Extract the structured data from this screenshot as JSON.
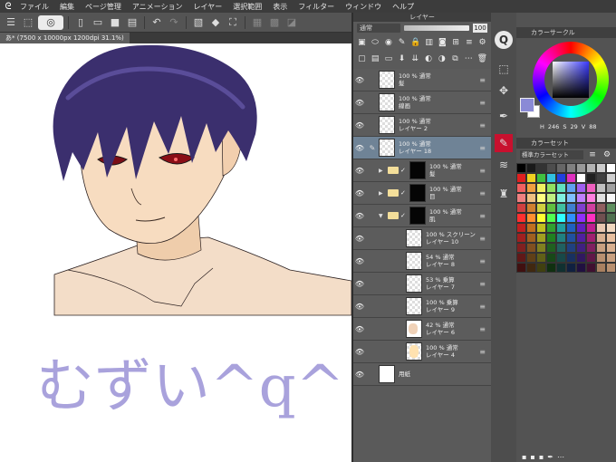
{
  "menubar": {
    "app_icon": "clip-studio-icon",
    "items": [
      "ファイル",
      "編集",
      "ページ管理",
      "アニメーション",
      "レイヤー",
      "選択範囲",
      "表示",
      "フィルター",
      "ウィンドウ",
      "ヘルプ"
    ]
  },
  "canvas_tab": {
    "label": "あ* (7500 x 10000px 1200dpi 31.1%)"
  },
  "canvas": {
    "handwriting": "むずい^q^",
    "handwriting_color": "#a9a2dc"
  },
  "layer_panel": {
    "title": "レイヤー",
    "blend_mode": "通常",
    "opacity": "100",
    "layers": [
      {
        "mode": "100 % 通常",
        "name": "髪"
      },
      {
        "mode": "100 % 通常",
        "name": "線画"
      },
      {
        "mode": "100 % 通常",
        "name": "レイヤー 2"
      },
      {
        "mode": "100 % 通常",
        "name": "レイヤー 18"
      },
      {
        "mode": "100 % 通常",
        "name": "髪"
      },
      {
        "mode": "100 % 通常",
        "name": "目"
      },
      {
        "mode": "100 % 通常",
        "name": "肌"
      },
      {
        "mode": "100 % スクリーン",
        "name": "レイヤー 10"
      },
      {
        "mode": "54 % 通常",
        "name": "レイヤー 8"
      },
      {
        "mode": "53 % 乗算",
        "name": "レイヤー 7"
      },
      {
        "mode": "100 % 乗算",
        "name": "レイヤー 9"
      },
      {
        "mode": "42 % 通常",
        "name": "レイヤー 6"
      },
      {
        "mode": "100 % 通常",
        "name": "レイヤー 4"
      },
      {
        "mode": "",
        "name": "用紙"
      }
    ]
  },
  "color_circle": {
    "title": "カラーサークル",
    "h": "246",
    "s": "29",
    "v": "88",
    "current_color": "#8a8ad6"
  },
  "color_set": {
    "title": "カラーセット",
    "set_name": "標準カラーセット"
  },
  "palette": [
    "#000000",
    "#1a1a1a",
    "#333333",
    "#4d4d4d",
    "#666666",
    "#808080",
    "#999999",
    "#b3b3b3",
    "#cccccc",
    "#ffffff",
    "#e02020",
    "#f0d020",
    "#40c040",
    "#30c0e0",
    "#2040e0",
    "#e030c0",
    "#ffffff",
    "#202020",
    "#404040",
    "#d0d0d0",
    "#f06060",
    "#f0a040",
    "#f0f060",
    "#90e060",
    "#60e0c0",
    "#60a0f0",
    "#a060f0",
    "#f060c0",
    "#c0c0c0",
    "#a0a0a0",
    "#f08080",
    "#f0c080",
    "#ffff80",
    "#c0f080",
    "#80f0e0",
    "#80c0ff",
    "#c080ff",
    "#ff80e0",
    "#e0e0e0",
    "#f8f8f8",
    "#d04040",
    "#d08030",
    "#d0d040",
    "#60c040",
    "#40c0a0",
    "#4080d0",
    "#8040d0",
    "#d040a0",
    "#906060",
    "#609060",
    "#ff3030",
    "#ff9030",
    "#ffff30",
    "#50ff50",
    "#30ffff",
    "#3090ff",
    "#9030ff",
    "#ff30c0",
    "#705050",
    "#507050",
    "#c02020",
    "#c07020",
    "#c0c020",
    "#30a030",
    "#20a0a0",
    "#2060c0",
    "#6020c0",
    "#c02090",
    "#e8c8b0",
    "#f0d8c0",
    "#a02020",
    "#a06020",
    "#a0a020",
    "#208020",
    "#208080",
    "#2050a0",
    "#5020a0",
    "#a02070",
    "#d8b090",
    "#e8c0a0",
    "#802020",
    "#805020",
    "#808020",
    "#206020",
    "#206060",
    "#204080",
    "#402080",
    "#802060",
    "#c8a080",
    "#d8b090",
    "#601818",
    "#604018",
    "#606018",
    "#184818",
    "#184848",
    "#183060",
    "#301860",
    "#601848",
    "#b89070",
    "#c8a080",
    "#401010",
    "#402810",
    "#404010",
    "#103010",
    "#103030",
    "#102040",
    "#201040",
    "#401030",
    "#a88060",
    "#b89070"
  ]
}
